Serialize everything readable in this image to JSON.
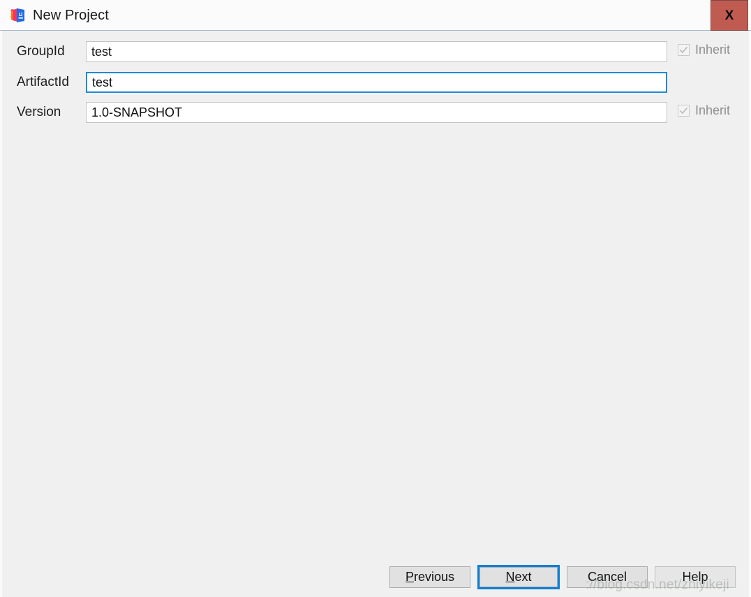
{
  "window": {
    "title": "New Project",
    "app_icon": "intellij-idea-icon",
    "close_label": "X"
  },
  "form": {
    "fields": [
      {
        "label": "GroupId",
        "value": "test",
        "focused": false,
        "inherit": {
          "label": "Inherit",
          "checked": true,
          "disabled": true
        }
      },
      {
        "label": "ArtifactId",
        "value": "test",
        "focused": true,
        "inherit": null
      },
      {
        "label": "Version",
        "value": "1.0-SNAPSHOT",
        "focused": false,
        "inherit": {
          "label": "Inherit",
          "checked": true,
          "disabled": true
        }
      }
    ]
  },
  "footer": {
    "buttons": [
      {
        "name": "previous",
        "mnemonic": "P",
        "rest": "revious",
        "default": false,
        "disabled": false
      },
      {
        "name": "next",
        "mnemonic": "N",
        "rest": "ext",
        "default": true,
        "disabled": false
      },
      {
        "name": "cancel",
        "mnemonic": "C",
        "rest": "ancel",
        "default": false,
        "disabled": false
      },
      {
        "name": "help",
        "mnemonic": "H",
        "rest": "elp",
        "default": false,
        "disabled": true
      }
    ]
  },
  "watermark": {
    "text": "://blog.csdn.net/zhiyikeji"
  },
  "colors": {
    "dialog_background": "#f0f0f0",
    "titlebar_background": "#fbfbfb",
    "titlebar_separator": "#a7b8c9",
    "close_button": "#c05b52",
    "focus_blue": "#0c7fd8",
    "input_border": "#c4c4c4",
    "button_face": "#e1e1e1",
    "disabled_text": "#8f8f8f"
  }
}
